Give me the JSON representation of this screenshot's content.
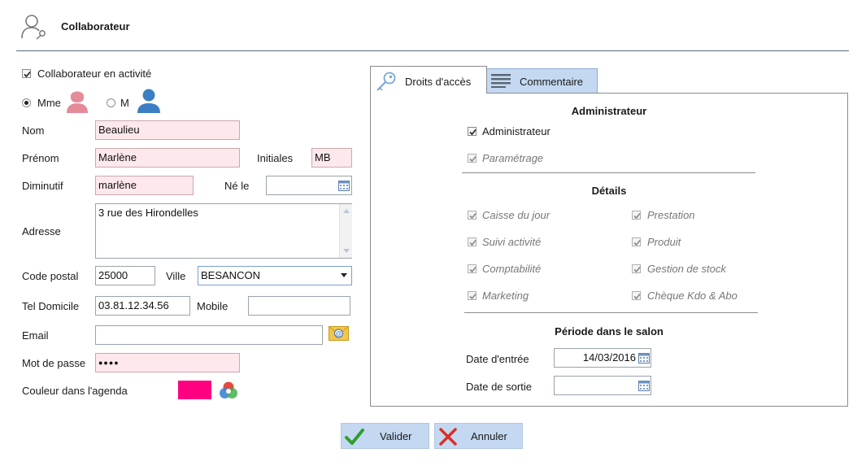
{
  "header": {
    "title": "Collaborateur",
    "icon": "user-key-icon"
  },
  "left": {
    "active_label": "Collaborateur en activité",
    "active_checked": true,
    "gender": {
      "mme_label": "Mme",
      "m_label": "M",
      "selected": "Mme"
    },
    "nom_label": "Nom",
    "nom_value": "Beaulieu",
    "prenom_label": "Prénom",
    "prenom_value": "Marlène",
    "initiales_label": "Initiales",
    "initiales_value": "MB",
    "diminutif_label": "Diminutif",
    "diminutif_value": "marlène",
    "ne_le_label": "Né le",
    "ne_le_value": "",
    "adresse_label": "Adresse",
    "adresse_value": "3 rue des Hirondelles",
    "cp_label": "Code postal",
    "cp_value": "25000",
    "ville_label": "Ville",
    "ville_value": "BESANCON",
    "tel_label": "Tel Domicile",
    "tel_value": "03.81.12.34.56",
    "mobile_label": "Mobile",
    "mobile_value": "",
    "email_label": "Email",
    "email_value": "",
    "password_label": "Mot de passe",
    "password_value": "●●●●",
    "couleur_label": "Couleur dans l'agenda",
    "couleur_value": "#ff0080"
  },
  "tabs": [
    {
      "label": "Droits d'accès",
      "icon": "key-icon",
      "active": true
    },
    {
      "label": "Commentaire",
      "icon": "lines-icon",
      "active": false
    }
  ],
  "rights": {
    "admin_title": "Administrateur",
    "admin_checkbox": "Administrateur",
    "parametrage": "Paramétrage",
    "details_title": "Détails",
    "details_left": [
      "Caisse du jour",
      "Suivi activité",
      "Comptabilité",
      "Marketing"
    ],
    "details_right": [
      "Prestation",
      "Produit",
      "Gestion de stock",
      "Chèque Kdo & Abo"
    ],
    "period_title": "Période dans le salon",
    "entree_label": "Date d'entrée",
    "entree_value": "14/03/2016",
    "sortie_label": "Date de sortie",
    "sortie_value": ""
  },
  "buttons": {
    "valider": "Valider",
    "annuler": "Annuler"
  },
  "colors": {
    "accent_blue": "#c4d9f1",
    "pink_field": "#fde8ec",
    "check_green": "#2e9e2e",
    "cross_red": "#d9302a"
  }
}
